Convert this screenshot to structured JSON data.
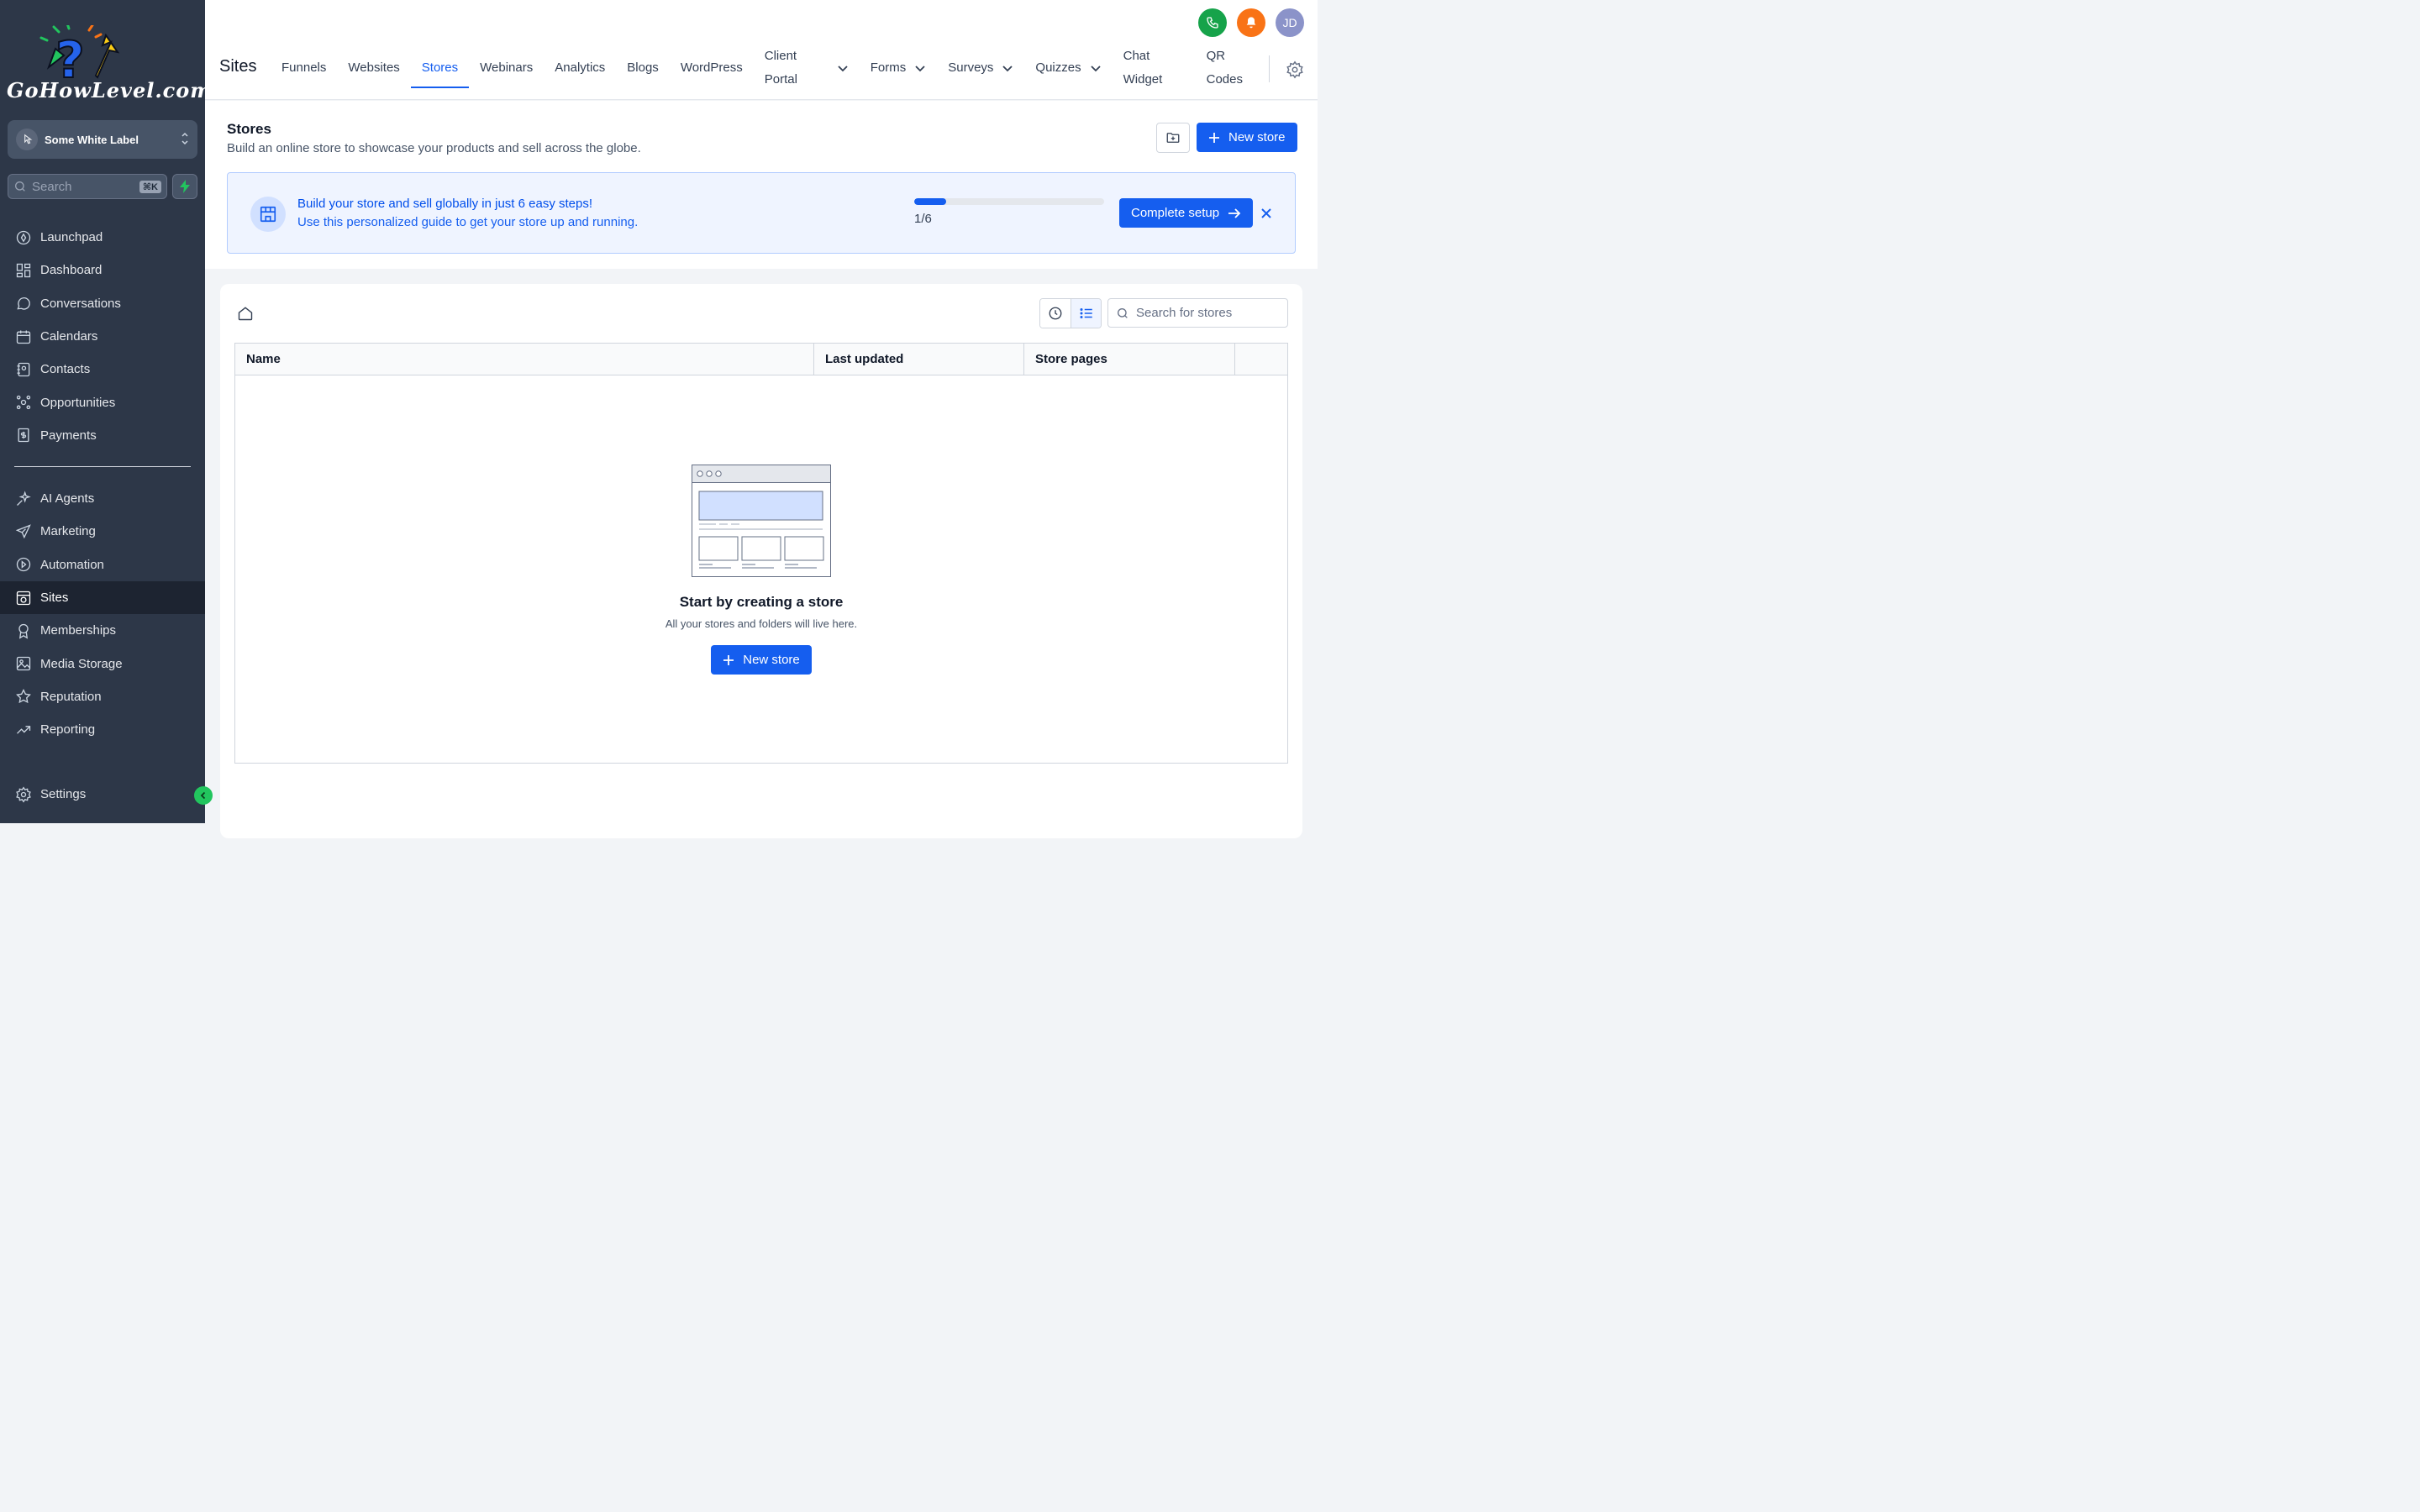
{
  "brand": {
    "logo_text": "GoHowLevel.com"
  },
  "sidebar": {
    "account_switcher": "Some White Label",
    "search": {
      "placeholder": "Search",
      "shortcut": "⌘K"
    },
    "items_primary": [
      {
        "label": "Launchpad",
        "icon": "rocket-icon"
      },
      {
        "label": "Dashboard",
        "icon": "grid-icon"
      },
      {
        "label": "Conversations",
        "icon": "chat-icon"
      },
      {
        "label": "Calendars",
        "icon": "calendar-icon"
      },
      {
        "label": "Contacts",
        "icon": "contacts-icon"
      },
      {
        "label": "Opportunities",
        "icon": "opportunities-icon"
      },
      {
        "label": "Payments",
        "icon": "payments-icon"
      }
    ],
    "items_secondary": [
      {
        "label": "AI Agents",
        "icon": "sparkle-icon"
      },
      {
        "label": "Marketing",
        "icon": "send-icon"
      },
      {
        "label": "Automation",
        "icon": "automation-icon"
      },
      {
        "label": "Sites",
        "icon": "sites-icon",
        "active": true
      },
      {
        "label": "Memberships",
        "icon": "badge-icon"
      },
      {
        "label": "Media Storage",
        "icon": "image-icon"
      },
      {
        "label": "Reputation",
        "icon": "star-icon"
      },
      {
        "label": "Reporting",
        "icon": "trend-icon"
      }
    ],
    "settings_label": "Settings"
  },
  "topbar": {
    "title": "Sites",
    "tabs": [
      {
        "label": "Funnels"
      },
      {
        "label": "Websites"
      },
      {
        "label": "Stores",
        "active": true
      },
      {
        "label": "Webinars"
      },
      {
        "label": "Analytics"
      },
      {
        "label": "Blogs"
      },
      {
        "label": "WordPress"
      },
      {
        "label": "Client Portal",
        "dropdown": true
      },
      {
        "label": "Forms",
        "dropdown": true
      },
      {
        "label": "Surveys",
        "dropdown": true
      },
      {
        "label": "Quizzes",
        "dropdown": true
      },
      {
        "label": "Chat Widget"
      },
      {
        "label": "QR Codes"
      }
    ],
    "avatar_initials": "JD",
    "colors": {
      "phone": "#16a34a",
      "bell": "#f97316",
      "avatar": "#8b93c9"
    }
  },
  "header": {
    "title": "Stores",
    "subtitle": "Build an online store to showcase your products and sell across the globe.",
    "new_store_label": "New store"
  },
  "banner": {
    "title": "Build your store and sell globally in just 6 easy steps!",
    "subtitle": "Use this personalized guide to get your store up and running.",
    "progress_fraction": 0.1667,
    "progress_label": "1/6",
    "cta_label": "Complete setup"
  },
  "content": {
    "search_placeholder": "Search for stores",
    "columns": [
      "Name",
      "Last updated",
      "Store pages",
      ""
    ],
    "empty": {
      "title": "Start by creating a store",
      "subtitle": "All your stores and folders will live here.",
      "cta_label": "New store"
    }
  },
  "accent_color": "#155eef"
}
